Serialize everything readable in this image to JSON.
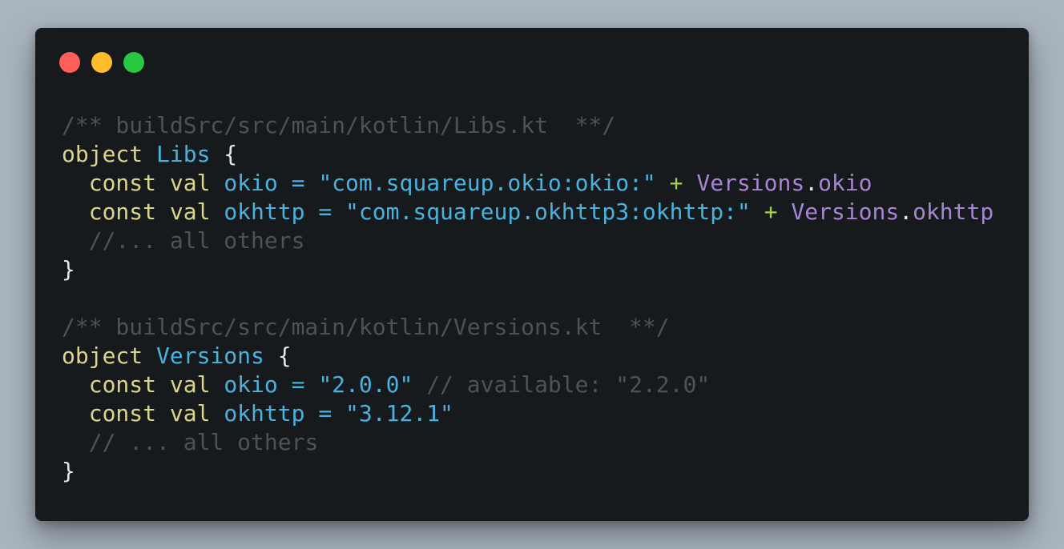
{
  "window": {
    "buttons": [
      {
        "name": "close",
        "color": "#ff5f57"
      },
      {
        "name": "minimize",
        "color": "#ffbd2e"
      },
      {
        "name": "zoom",
        "color": "#28c840"
      }
    ]
  },
  "code": {
    "lines": [
      {
        "tokens": [
          {
            "t": "c",
            "v": "/** buildSrc/src/main/kotlin/Libs.kt  **/"
          }
        ]
      },
      {
        "tokens": [
          {
            "t": "k",
            "v": "object"
          },
          {
            "t": "p",
            "v": " "
          },
          {
            "t": "n",
            "v": "Libs"
          },
          {
            "t": "p",
            "v": " {"
          }
        ]
      },
      {
        "tokens": [
          {
            "t": "p",
            "v": "  "
          },
          {
            "t": "k",
            "v": "const"
          },
          {
            "t": "p",
            "v": " "
          },
          {
            "t": "k",
            "v": "val"
          },
          {
            "t": "p",
            "v": " "
          },
          {
            "t": "n",
            "v": "okio"
          },
          {
            "t": "p",
            "v": " "
          },
          {
            "t": "n",
            "v": "="
          },
          {
            "t": "p",
            "v": " "
          },
          {
            "t": "s",
            "v": "\"com.squareup.okio:okio:\""
          },
          {
            "t": "p",
            "v": " "
          },
          {
            "t": "op",
            "v": "+"
          },
          {
            "t": "p",
            "v": " "
          },
          {
            "t": "cl",
            "v": "Versions"
          },
          {
            "t": "p",
            "v": "."
          },
          {
            "t": "m",
            "v": "okio"
          }
        ]
      },
      {
        "tokens": [
          {
            "t": "p",
            "v": "  "
          },
          {
            "t": "k",
            "v": "const"
          },
          {
            "t": "p",
            "v": " "
          },
          {
            "t": "k",
            "v": "val"
          },
          {
            "t": "p",
            "v": " "
          },
          {
            "t": "n",
            "v": "okhttp"
          },
          {
            "t": "p",
            "v": " "
          },
          {
            "t": "n",
            "v": "="
          },
          {
            "t": "p",
            "v": " "
          },
          {
            "t": "s",
            "v": "\"com.squareup.okhttp3:okhttp:\""
          },
          {
            "t": "p",
            "v": " "
          },
          {
            "t": "op",
            "v": "+"
          },
          {
            "t": "p",
            "v": " "
          },
          {
            "t": "cl",
            "v": "Versions"
          },
          {
            "t": "p",
            "v": "."
          },
          {
            "t": "m",
            "v": "okhttp"
          }
        ]
      },
      {
        "tokens": [
          {
            "t": "p",
            "v": "  "
          },
          {
            "t": "c",
            "v": "//... all others"
          }
        ]
      },
      {
        "tokens": [
          {
            "t": "p",
            "v": "}"
          }
        ]
      },
      {
        "tokens": [
          {
            "t": "p",
            "v": ""
          }
        ]
      },
      {
        "tokens": [
          {
            "t": "c",
            "v": "/** buildSrc/src/main/kotlin/Versions.kt  **/"
          }
        ]
      },
      {
        "tokens": [
          {
            "t": "k",
            "v": "object"
          },
          {
            "t": "p",
            "v": " "
          },
          {
            "t": "n",
            "v": "Versions"
          },
          {
            "t": "p",
            "v": " {"
          }
        ]
      },
      {
        "tokens": [
          {
            "t": "p",
            "v": "  "
          },
          {
            "t": "k",
            "v": "const"
          },
          {
            "t": "p",
            "v": " "
          },
          {
            "t": "k",
            "v": "val"
          },
          {
            "t": "p",
            "v": " "
          },
          {
            "t": "n",
            "v": "okio"
          },
          {
            "t": "p",
            "v": " "
          },
          {
            "t": "n",
            "v": "="
          },
          {
            "t": "p",
            "v": " "
          },
          {
            "t": "s",
            "v": "\"2.0.0\""
          },
          {
            "t": "p",
            "v": " "
          },
          {
            "t": "c",
            "v": "// available: \"2.2.0\""
          }
        ]
      },
      {
        "tokens": [
          {
            "t": "p",
            "v": "  "
          },
          {
            "t": "k",
            "v": "const"
          },
          {
            "t": "p",
            "v": " "
          },
          {
            "t": "k",
            "v": "val"
          },
          {
            "t": "p",
            "v": " "
          },
          {
            "t": "n",
            "v": "okhttp"
          },
          {
            "t": "p",
            "v": " "
          },
          {
            "t": "n",
            "v": "="
          },
          {
            "t": "p",
            "v": " "
          },
          {
            "t": "s",
            "v": "\"3.12.1\""
          }
        ]
      },
      {
        "tokens": [
          {
            "t": "p",
            "v": "  "
          },
          {
            "t": "c",
            "v": "// ... all others"
          }
        ]
      },
      {
        "tokens": [
          {
            "t": "p",
            "v": "}"
          }
        ]
      }
    ]
  }
}
